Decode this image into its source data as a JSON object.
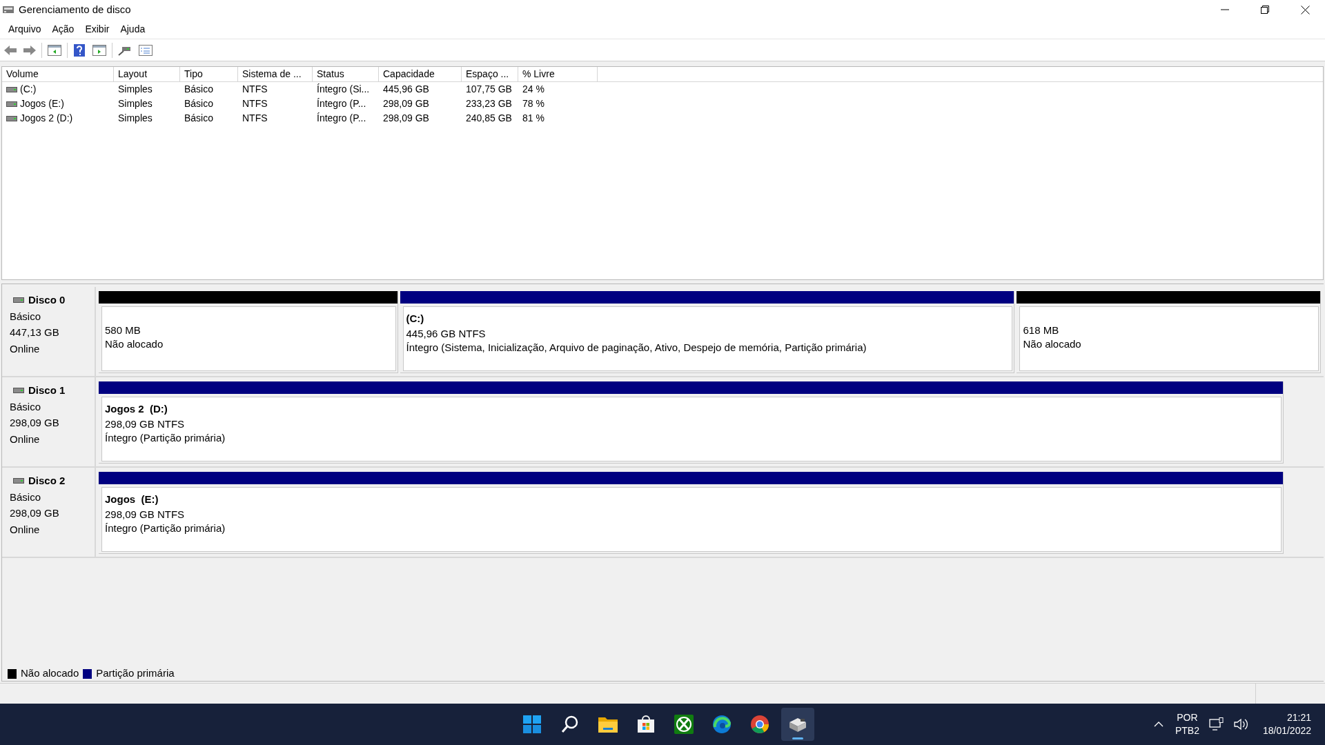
{
  "window": {
    "title": "Gerenciamento de disco"
  },
  "menu": [
    "Arquivo",
    "Ação",
    "Exibir",
    "Ajuda"
  ],
  "table": {
    "columns": [
      "Volume",
      "Layout",
      "Tipo",
      "Sistema de ...",
      "Status",
      "Capacidade",
      "Espaço ...",
      "% Livre"
    ],
    "rows": [
      [
        "(C:)",
        "Simples",
        "Básico",
        "NTFS",
        "Íntegro (Si...",
        "445,96 GB",
        "107,75 GB",
        "24 %"
      ],
      [
        "Jogos (E:)",
        "Simples",
        "Básico",
        "NTFS",
        "Íntegro (P...",
        "298,09 GB",
        "233,23 GB",
        "78 %"
      ],
      [
        "Jogos 2 (D:)",
        "Simples",
        "Básico",
        "NTFS",
        "Íntegro (P...",
        "298,09 GB",
        "240,85 GB",
        "81 %"
      ]
    ]
  },
  "disks": [
    {
      "name": "Disco 0",
      "type": "Básico",
      "size": "447,13 GB",
      "status": "Online",
      "partitions": [
        {
          "kind": "unallocated",
          "lines": [
            "580 MB",
            "Não alocado"
          ]
        },
        {
          "kind": "primary",
          "name": "(C:)",
          "lines": [
            "445,96 GB NTFS",
            "Íntegro (Sistema, Inicialização, Arquivo de paginação, Ativo, Despejo de memória, Partição primária)"
          ]
        },
        {
          "kind": "unallocated",
          "lines": [
            "618 MB",
            "Não alocado"
          ]
        }
      ]
    },
    {
      "name": "Disco 1",
      "type": "Básico",
      "size": "298,09 GB",
      "status": "Online",
      "partitions": [
        {
          "kind": "primary",
          "name": "Jogos 2  (D:)",
          "lines": [
            "298,09 GB NTFS",
            "Íntegro (Partição primária)"
          ]
        }
      ]
    },
    {
      "name": "Disco 2",
      "type": "Básico",
      "size": "298,09 GB",
      "status": "Online",
      "partitions": [
        {
          "kind": "primary",
          "name": "Jogos  (E:)",
          "lines": [
            "298,09 GB NTFS",
            "Íntegro (Partição primária)"
          ]
        }
      ]
    }
  ],
  "legend": [
    {
      "label": "Não alocado",
      "color": "#000000"
    },
    {
      "label": "Partição primária",
      "color": "#000080"
    }
  ],
  "taskbar": {
    "apps": [
      {
        "kind": "start",
        "selected": false
      },
      {
        "kind": "search",
        "selected": false
      },
      {
        "kind": "folder",
        "selected": false
      },
      {
        "kind": "store",
        "selected": false
      },
      {
        "kind": "xbox",
        "selected": false
      },
      {
        "kind": "edge",
        "selected": false
      },
      {
        "kind": "chrome",
        "selected": false
      },
      {
        "kind": "disk",
        "selected": true
      }
    ],
    "language": [
      "POR",
      "PTB2"
    ],
    "time": "21:21",
    "date": "18/01/2022"
  }
}
